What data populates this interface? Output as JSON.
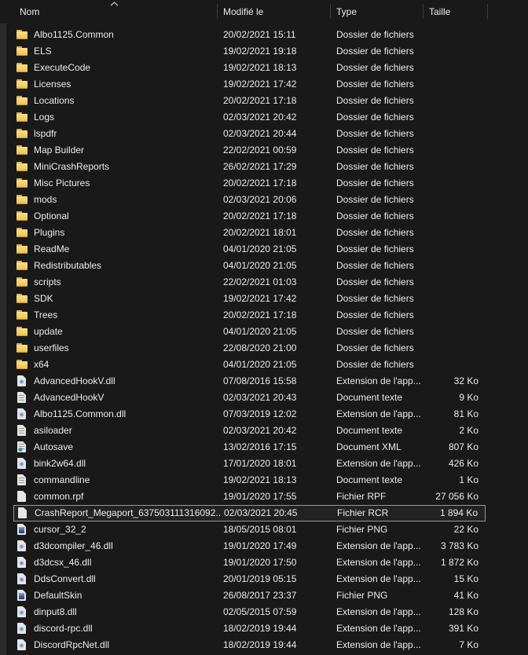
{
  "header": {
    "columns": [
      {
        "label": "Nom",
        "sorted": "ascending"
      },
      {
        "label": "Modifié le"
      },
      {
        "label": "Type"
      },
      {
        "label": "Taille"
      }
    ]
  },
  "rows": [
    {
      "icon": "folder",
      "name": "Albo1125.Common",
      "date": "20/02/2021 15:11",
      "type": "Dossier de fichiers",
      "size": ""
    },
    {
      "icon": "folder",
      "name": "ELS",
      "date": "19/02/2021 19:18",
      "type": "Dossier de fichiers",
      "size": ""
    },
    {
      "icon": "folder",
      "name": "ExecuteCode",
      "date": "19/02/2021 18:13",
      "type": "Dossier de fichiers",
      "size": ""
    },
    {
      "icon": "folder",
      "name": "Licenses",
      "date": "19/02/2021 17:42",
      "type": "Dossier de fichiers",
      "size": ""
    },
    {
      "icon": "folder",
      "name": "Locations",
      "date": "20/02/2021 17:18",
      "type": "Dossier de fichiers",
      "size": ""
    },
    {
      "icon": "folder",
      "name": "Logs",
      "date": "02/03/2021 20:42",
      "type": "Dossier de fichiers",
      "size": ""
    },
    {
      "icon": "folder",
      "name": "lspdfr",
      "date": "02/03/2021 20:44",
      "type": "Dossier de fichiers",
      "size": ""
    },
    {
      "icon": "folder",
      "name": "Map Builder",
      "date": "22/02/2021 00:59",
      "type": "Dossier de fichiers",
      "size": ""
    },
    {
      "icon": "folder",
      "name": "MiniCrashReports",
      "date": "26/02/2021 17:29",
      "type": "Dossier de fichiers",
      "size": ""
    },
    {
      "icon": "folder",
      "name": "Misc Pictures",
      "date": "20/02/2021 17:18",
      "type": "Dossier de fichiers",
      "size": ""
    },
    {
      "icon": "folder",
      "name": "mods",
      "date": "02/03/2021 20:06",
      "type": "Dossier de fichiers",
      "size": ""
    },
    {
      "icon": "folder",
      "name": "Optional",
      "date": "20/02/2021 17:18",
      "type": "Dossier de fichiers",
      "size": ""
    },
    {
      "icon": "folder",
      "name": "Plugins",
      "date": "20/02/2021 18:01",
      "type": "Dossier de fichiers",
      "size": ""
    },
    {
      "icon": "folder",
      "name": "ReadMe",
      "date": "04/01/2020 21:05",
      "type": "Dossier de fichiers",
      "size": ""
    },
    {
      "icon": "folder",
      "name": "Redistributables",
      "date": "04/01/2020 21:05",
      "type": "Dossier de fichiers",
      "size": ""
    },
    {
      "icon": "folder",
      "name": "scripts",
      "date": "22/02/2021 01:03",
      "type": "Dossier de fichiers",
      "size": ""
    },
    {
      "icon": "folder",
      "name": "SDK",
      "date": "19/02/2021 17:42",
      "type": "Dossier de fichiers",
      "size": ""
    },
    {
      "icon": "folder",
      "name": "Trees",
      "date": "20/02/2021 17:18",
      "type": "Dossier de fichiers",
      "size": ""
    },
    {
      "icon": "folder",
      "name": "update",
      "date": "04/01/2020 21:05",
      "type": "Dossier de fichiers",
      "size": ""
    },
    {
      "icon": "folder",
      "name": "userfiles",
      "date": "22/08/2020 21:00",
      "type": "Dossier de fichiers",
      "size": ""
    },
    {
      "icon": "folder",
      "name": "x64",
      "date": "04/01/2020 21:05",
      "type": "Dossier de fichiers",
      "size": ""
    },
    {
      "icon": "dll",
      "name": "AdvancedHookV.dll",
      "date": "07/08/2016 15:58",
      "type": "Extension de l'app...",
      "size": "32 Ko"
    },
    {
      "icon": "txt",
      "name": "AdvancedHookV",
      "date": "02/03/2021 20:43",
      "type": "Document texte",
      "size": "9 Ko"
    },
    {
      "icon": "dll",
      "name": "Albo1125.Common.dll",
      "date": "07/03/2019 12:02",
      "type": "Extension de l'app...",
      "size": "81 Ko"
    },
    {
      "icon": "txt",
      "name": "asiloader",
      "date": "02/03/2021 20:42",
      "type": "Document texte",
      "size": "2 Ko"
    },
    {
      "icon": "xml",
      "name": "Autosave",
      "date": "13/02/2016 17:15",
      "type": "Document XML",
      "size": "807 Ko"
    },
    {
      "icon": "dll",
      "name": "bink2w64.dll",
      "date": "17/01/2020 18:01",
      "type": "Extension de l'app...",
      "size": "426 Ko"
    },
    {
      "icon": "txt",
      "name": "commandline",
      "date": "19/02/2021 18:13",
      "type": "Document texte",
      "size": "1 Ko"
    },
    {
      "icon": "file",
      "name": "common.rpf",
      "date": "19/01/2020 17:55",
      "type": "Fichier RPF",
      "size": "27 056 Ko"
    },
    {
      "icon": "file",
      "name": "CrashReport_Megaport_637503111316092...",
      "date": "02/03/2021 20:45",
      "type": "Fichier RCR",
      "size": "1 894 Ko",
      "selected": true
    },
    {
      "icon": "png",
      "name": "cursor_32_2",
      "date": "18/05/2015 08:01",
      "type": "Fichier PNG",
      "size": "22 Ko"
    },
    {
      "icon": "dll",
      "name": "d3dcompiler_46.dll",
      "date": "19/01/2020 17:49",
      "type": "Extension de l'app...",
      "size": "3 783 Ko"
    },
    {
      "icon": "dll",
      "name": "d3dcsx_46.dll",
      "date": "19/01/2020 17:50",
      "type": "Extension de l'app...",
      "size": "1 872 Ko"
    },
    {
      "icon": "dll",
      "name": "DdsConvert.dll",
      "date": "20/01/2019 05:15",
      "type": "Extension de l'app...",
      "size": "15 Ko"
    },
    {
      "icon": "png",
      "name": "DefaultSkin",
      "date": "26/08/2017 23:37",
      "type": "Fichier PNG",
      "size": "41 Ko"
    },
    {
      "icon": "dll",
      "name": "dinput8.dll",
      "date": "02/05/2015 07:59",
      "type": "Extension de l'app...",
      "size": "128 Ko"
    },
    {
      "icon": "dll",
      "name": "discord-rpc.dll",
      "date": "18/02/2019 19:44",
      "type": "Extension de l'app...",
      "size": "391 Ko"
    },
    {
      "icon": "dll",
      "name": "DiscordRpcNet.dll",
      "date": "18/02/2019 19:44",
      "type": "Extension de l'app...",
      "size": "7 Ko"
    }
  ],
  "colors": {
    "background": "#191919",
    "left_strip": "#2b2b2b",
    "text": "#ececec",
    "separator": "#3c3c3c",
    "selection_border": "#979797",
    "folder_yellow": "#f3cf66"
  }
}
